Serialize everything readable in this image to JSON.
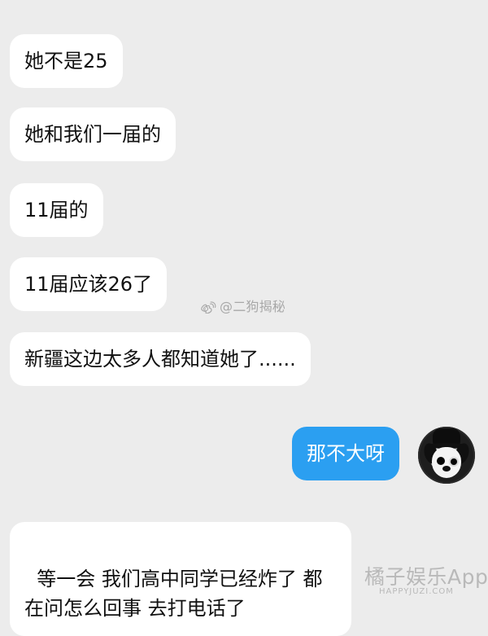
{
  "messages": [
    {
      "text": "她不是25"
    },
    {
      "text": "她和我们一届的"
    },
    {
      "text": "11届的"
    },
    {
      "text": "11届应该26了"
    },
    {
      "text": "新疆这边太多人都知道她了......"
    },
    {
      "text": "那不大呀"
    },
    {
      "text": "等一会 我们高中同学已经炸了 都\n在问怎么回事 去打电话了"
    }
  ],
  "watermarks": {
    "weibo_text": "@二狗揭秘",
    "brand_top": "橘子娱乐App",
    "brand_bottom": "HAPPYJUZI.COM"
  },
  "icons": {
    "weibo": "weibo-icon",
    "avatar": "avatar-icon"
  },
  "colors": {
    "background": "#ececec",
    "incoming_bubble": "#ffffff",
    "outgoing_bubble": "#2b9ff1",
    "text": "#111111",
    "watermark": "#a8a8a8"
  }
}
